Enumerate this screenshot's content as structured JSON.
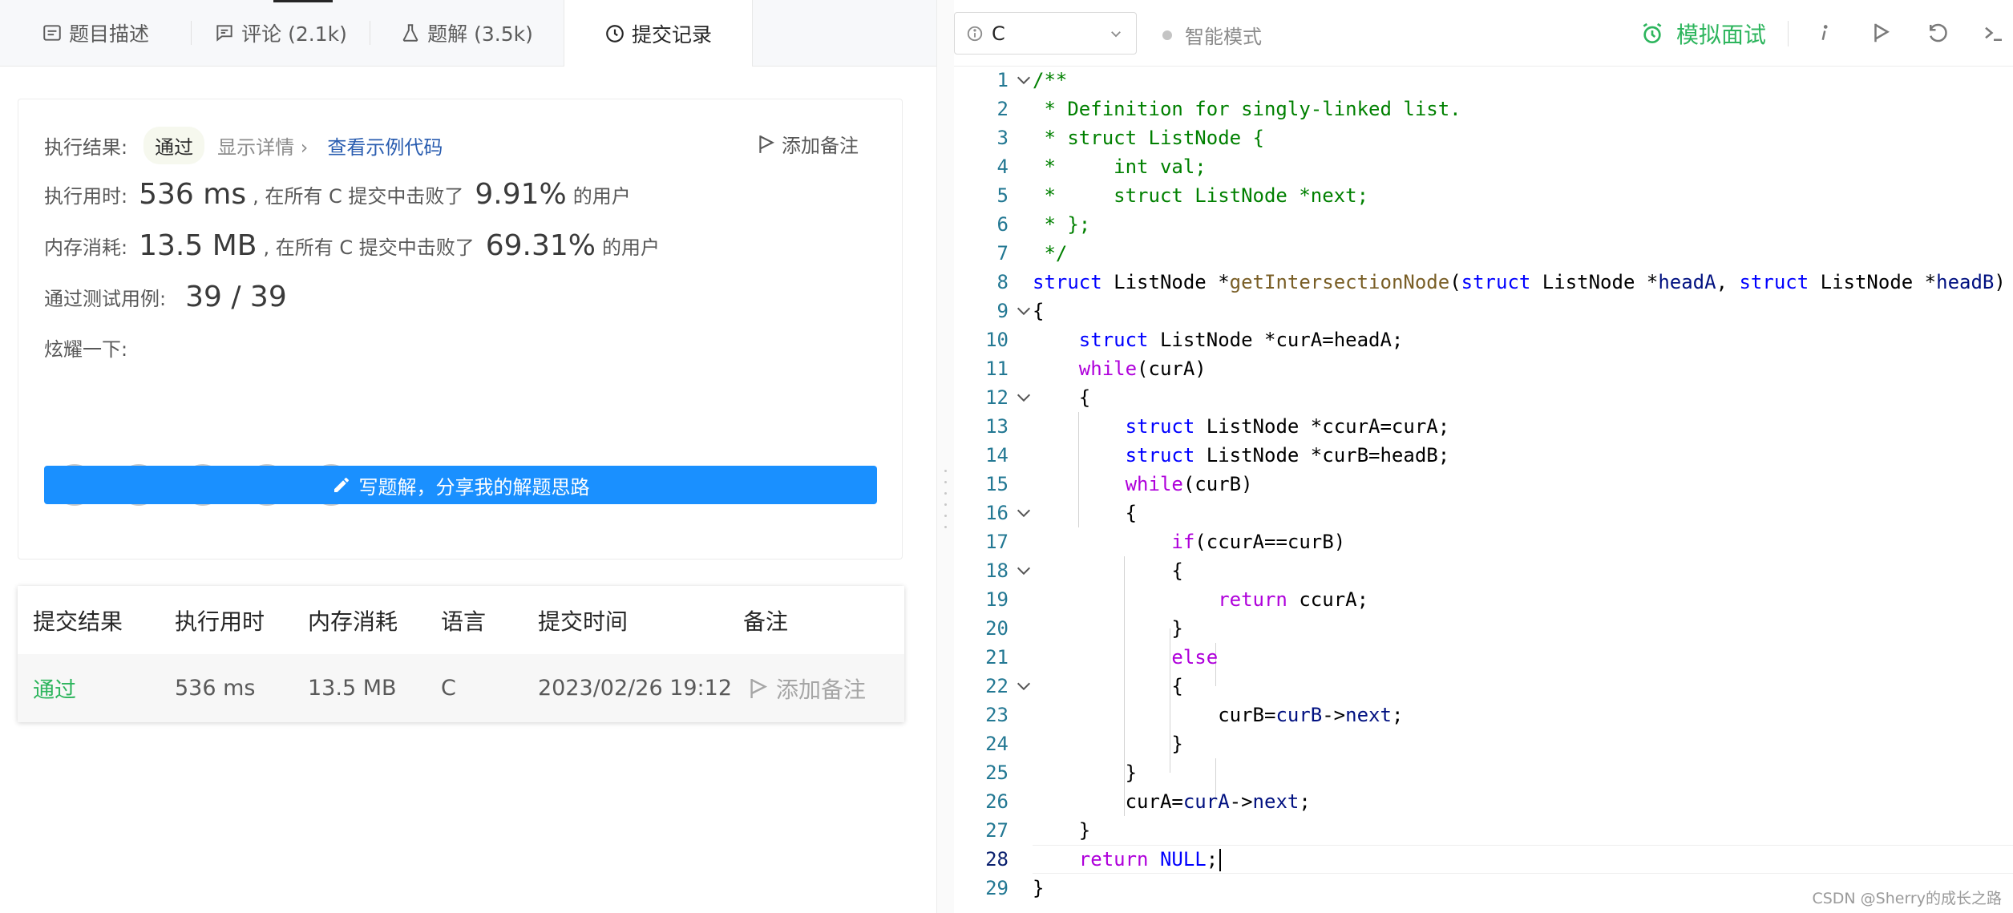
{
  "tabs": [
    {
      "label": "题目描述"
    },
    {
      "label": "评论 (2.1k)"
    },
    {
      "label": "题解 (3.5k)"
    },
    {
      "label": "提交记录"
    }
  ],
  "result": {
    "status_label": "执行结果:",
    "status_value": "通过",
    "detail_link": "显示详情 ›",
    "sample_link": "查看示例代码",
    "add_note": "添加备注",
    "runtime_label": "执行用时:",
    "runtime_value": "536 ms",
    "runtime_text": ", 在所有 C 提交中击败了",
    "runtime_percent": "9.91%",
    "users_suffix": "的用户",
    "memory_label": "内存消耗:",
    "memory_value": "13.5 MB",
    "memory_text": ", 在所有 C 提交中击败了",
    "memory_percent": "69.31%",
    "tests_label": "通过测试用例:",
    "tests_value": "39 / 39",
    "share_label": "炫耀一下:",
    "share_icons": [
      "wechat-icon",
      "weibo-icon",
      "qq-icon",
      "douban-icon",
      "linkedin-icon"
    ],
    "write_button": "写题解，分享我的解题思路"
  },
  "submissions": {
    "headers": [
      "提交结果",
      "执行用时",
      "内存消耗",
      "语言",
      "提交时间",
      "备注"
    ],
    "rows": [
      {
        "result": "通过",
        "runtime": "536 ms",
        "memory": "13.5 MB",
        "language": "C",
        "time": "2023/02/26 19:12",
        "note": "添加备注"
      }
    ]
  },
  "editor": {
    "language": "C",
    "smart_mode": "智能模式",
    "interview": "模拟面试",
    "line_numbers": [
      "1",
      "2",
      "3",
      "4",
      "5",
      "6",
      "7",
      "8",
      "9",
      "10",
      "11",
      "12",
      "13",
      "14",
      "15",
      "16",
      "17",
      "18",
      "19",
      "20",
      "21",
      "22",
      "23",
      "24",
      "25",
      "26",
      "27",
      "28",
      "29"
    ],
    "lines": [
      "/**",
      " * Definition for singly-linked list.",
      " * struct ListNode {",
      " *     int val;",
      " *     struct ListNode *next;",
      " * };",
      " */",
      "struct ListNode *getIntersectionNode(struct ListNode *headA, struct ListNode *headB)",
      "{",
      "    struct ListNode *curA=headA;",
      "    while(curA)",
      "    {",
      "        struct ListNode *ccurA=curA;",
      "        struct ListNode *curB=headB;",
      "        while(curB)",
      "        {",
      "            if(ccurA==curB)",
      "            {",
      "                return ccurA;",
      "            }",
      "            else",
      "            {",
      "                curB=curB->next;",
      "            }",
      "        }",
      "        curA=curA->next;",
      "    }",
      "    return NULL;",
      "}"
    ]
  },
  "watermark": "CSDN @Sherry的成长之路",
  "colors": {
    "accent_blue": "#1a90ff",
    "success_green": "#2db55d",
    "keyword": "#0000ff",
    "comment": "#008000",
    "control": "#af00db"
  }
}
